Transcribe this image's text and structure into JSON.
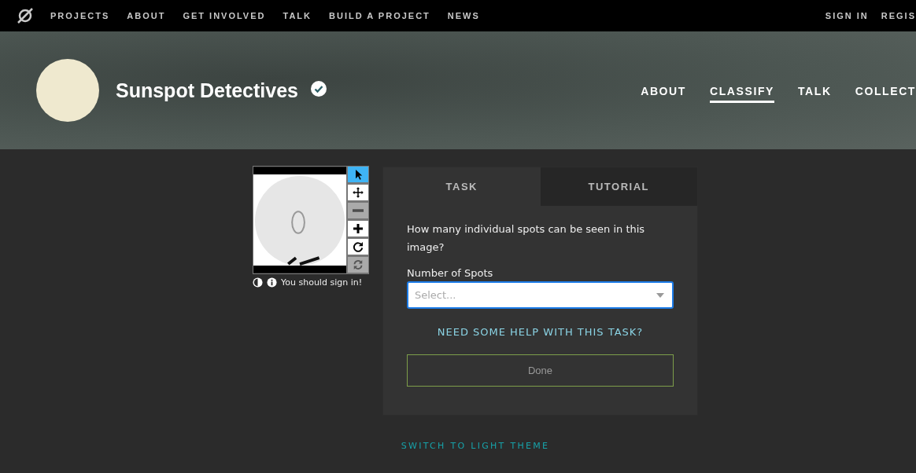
{
  "top_nav": {
    "links": [
      "PROJECTS",
      "ABOUT",
      "GET INVOLVED",
      "TALK",
      "BUILD A PROJECT",
      "NEWS"
    ],
    "account": [
      "SIGN IN",
      "REGIS"
    ]
  },
  "project": {
    "title": "Sunspot Detectives",
    "verified": true,
    "nav": [
      {
        "label": "ABOUT",
        "selected": false
      },
      {
        "label": "CLASSIFY",
        "selected": true
      },
      {
        "label": "TALK",
        "selected": false
      },
      {
        "label": "COLLECT",
        "selected": false
      }
    ]
  },
  "viewer": {
    "tools": [
      {
        "kind": "pointer",
        "selected": true,
        "disabled": false
      },
      {
        "kind": "move",
        "selected": false,
        "disabled": false
      },
      {
        "kind": "zoom-out",
        "selected": false,
        "disabled": true
      },
      {
        "kind": "zoom-in",
        "selected": false,
        "disabled": false
      },
      {
        "kind": "rotate",
        "selected": false,
        "disabled": false
      },
      {
        "kind": "reset",
        "selected": false,
        "disabled": true
      }
    ],
    "notice": "You should sign in!"
  },
  "task_panel": {
    "tabs": [
      {
        "label": "TASK",
        "selected": true
      },
      {
        "label": "TUTORIAL",
        "selected": false
      }
    ],
    "question": "How many individual spots can be seen in this image?",
    "field_label": "Number of Spots",
    "dropdown": {
      "placeholder": "Select..."
    },
    "help_link": "NEED SOME HELP WITH THIS TASK?",
    "done_button": {
      "label": "Done",
      "disabled": true
    }
  },
  "theme_link": "SWITCH TO LIGHT THEME"
}
